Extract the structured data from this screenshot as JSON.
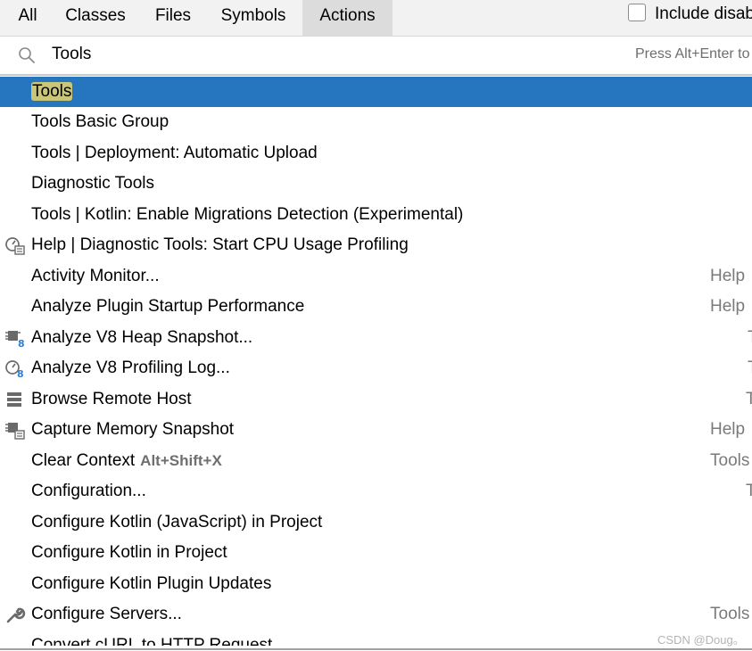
{
  "tabs": [
    {
      "label": "All"
    },
    {
      "label": "Classes"
    },
    {
      "label": "Files"
    },
    {
      "label": "Symbols"
    },
    {
      "label": "Actions"
    }
  ],
  "include_disabled": {
    "label": "Include disab",
    "checked": false
  },
  "search": {
    "value": "Tools",
    "hint": "Press Alt+Enter to"
  },
  "results": [
    {
      "label": "Tools",
      "icon": "",
      "group": ""
    },
    {
      "label": "Tools Basic Group",
      "icon": "",
      "group": ""
    },
    {
      "label": "Tools | Deployment: Automatic Upload",
      "icon": "",
      "group": ""
    },
    {
      "label": "Diagnostic Tools",
      "icon": "",
      "group": ""
    },
    {
      "label": "Tools | Kotlin: Enable Migrations Detection (Experimental)",
      "icon": "",
      "group": ""
    },
    {
      "label": "Help | Diagnostic Tools: Start CPU Usage Profiling",
      "icon": "cpu-profiling-icon",
      "group": ""
    },
    {
      "label": "Activity Monitor...",
      "icon": "",
      "group": "Help"
    },
    {
      "label": "Analyze Plugin Startup Performance",
      "icon": "",
      "group": "Help"
    },
    {
      "label": "Analyze V8 Heap Snapshot...",
      "icon": "v8-heap-icon",
      "group": "T"
    },
    {
      "label": "Analyze V8 Profiling Log...",
      "icon": "v8-profiling-icon",
      "group": "T"
    },
    {
      "label": "Browse Remote Host",
      "icon": "server-icon",
      "group": "T"
    },
    {
      "label": "Capture Memory Snapshot",
      "icon": "memory-snapshot-icon",
      "group": "Help"
    },
    {
      "label": "Clear Context",
      "shortcut": "Alt+Shift+X",
      "icon": "",
      "group": "Tools"
    },
    {
      "label": "Configuration...",
      "icon": "",
      "group": "T"
    },
    {
      "label": "Configure Kotlin (JavaScript) in Project",
      "icon": "",
      "group": ""
    },
    {
      "label": "Configure Kotlin in Project",
      "icon": "",
      "group": ""
    },
    {
      "label": "Configure Kotlin Plugin Updates",
      "icon": "",
      "group": ""
    },
    {
      "label": "Configure Servers...",
      "icon": "wrench-icon",
      "group": "Tools"
    },
    {
      "label": "Convert cURL to HTTP Request",
      "icon": "",
      "group": ""
    }
  ],
  "watermark": "CSDN @Doug。"
}
